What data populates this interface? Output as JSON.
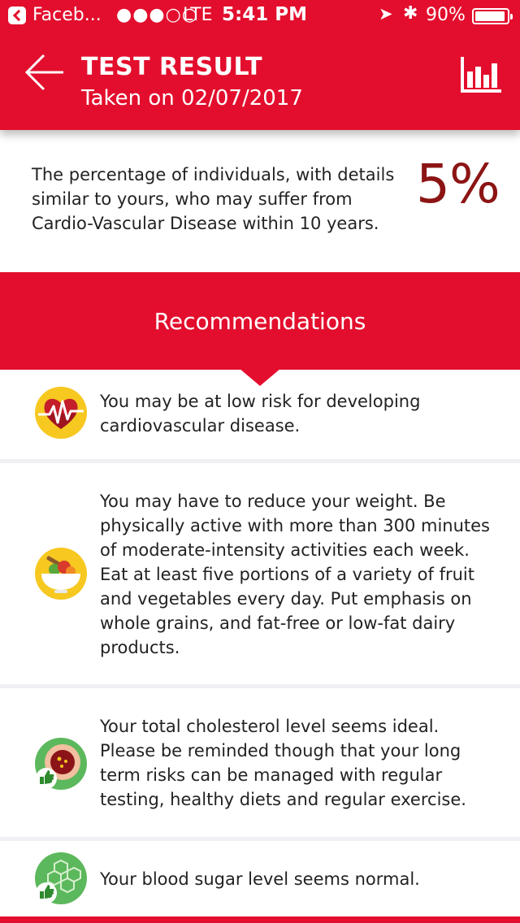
{
  "status_bar": {
    "back_app": "Faceb...",
    "signal_dots": "●●●○○",
    "carrier": "LTE",
    "time": "5:41 PM",
    "battery_pct": "90%"
  },
  "header": {
    "title": "TEST RESULT",
    "subtitle": "Taken on 02/07/2017"
  },
  "risk": {
    "text": "The percentage of individuals, with details similar to yours, who may suffer from Cardio-Vascular Disease within 10 years.",
    "percentage": "5%"
  },
  "recommendations": {
    "title": "Recommendations",
    "items": [
      {
        "icon": "heart-rate-icon",
        "text": "You may be at low risk for developing cardiovascular disease."
      },
      {
        "icon": "healthy-food-bowl-icon",
        "text": "You may have to reduce your weight. Be physically active with more than 300 minutes of moderate-intensity activities each week. Eat at least five portions of a variety of fruit and vegetables every day. Put emphasis on whole grains, and fat-free or low-fat dairy products."
      },
      {
        "icon": "cholesterol-thumbs-up-icon",
        "text": "Your total cholesterol level seems ideal. Please be reminded though that your long term risks can be managed with regular testing, healthy diets and regular exercise."
      },
      {
        "icon": "blood-sugar-thumbs-up-icon",
        "text": "Your blood sugar level seems normal."
      }
    ]
  },
  "colors": {
    "brand_red": "#e30e2d",
    "percentage_color": "#8c1414"
  }
}
